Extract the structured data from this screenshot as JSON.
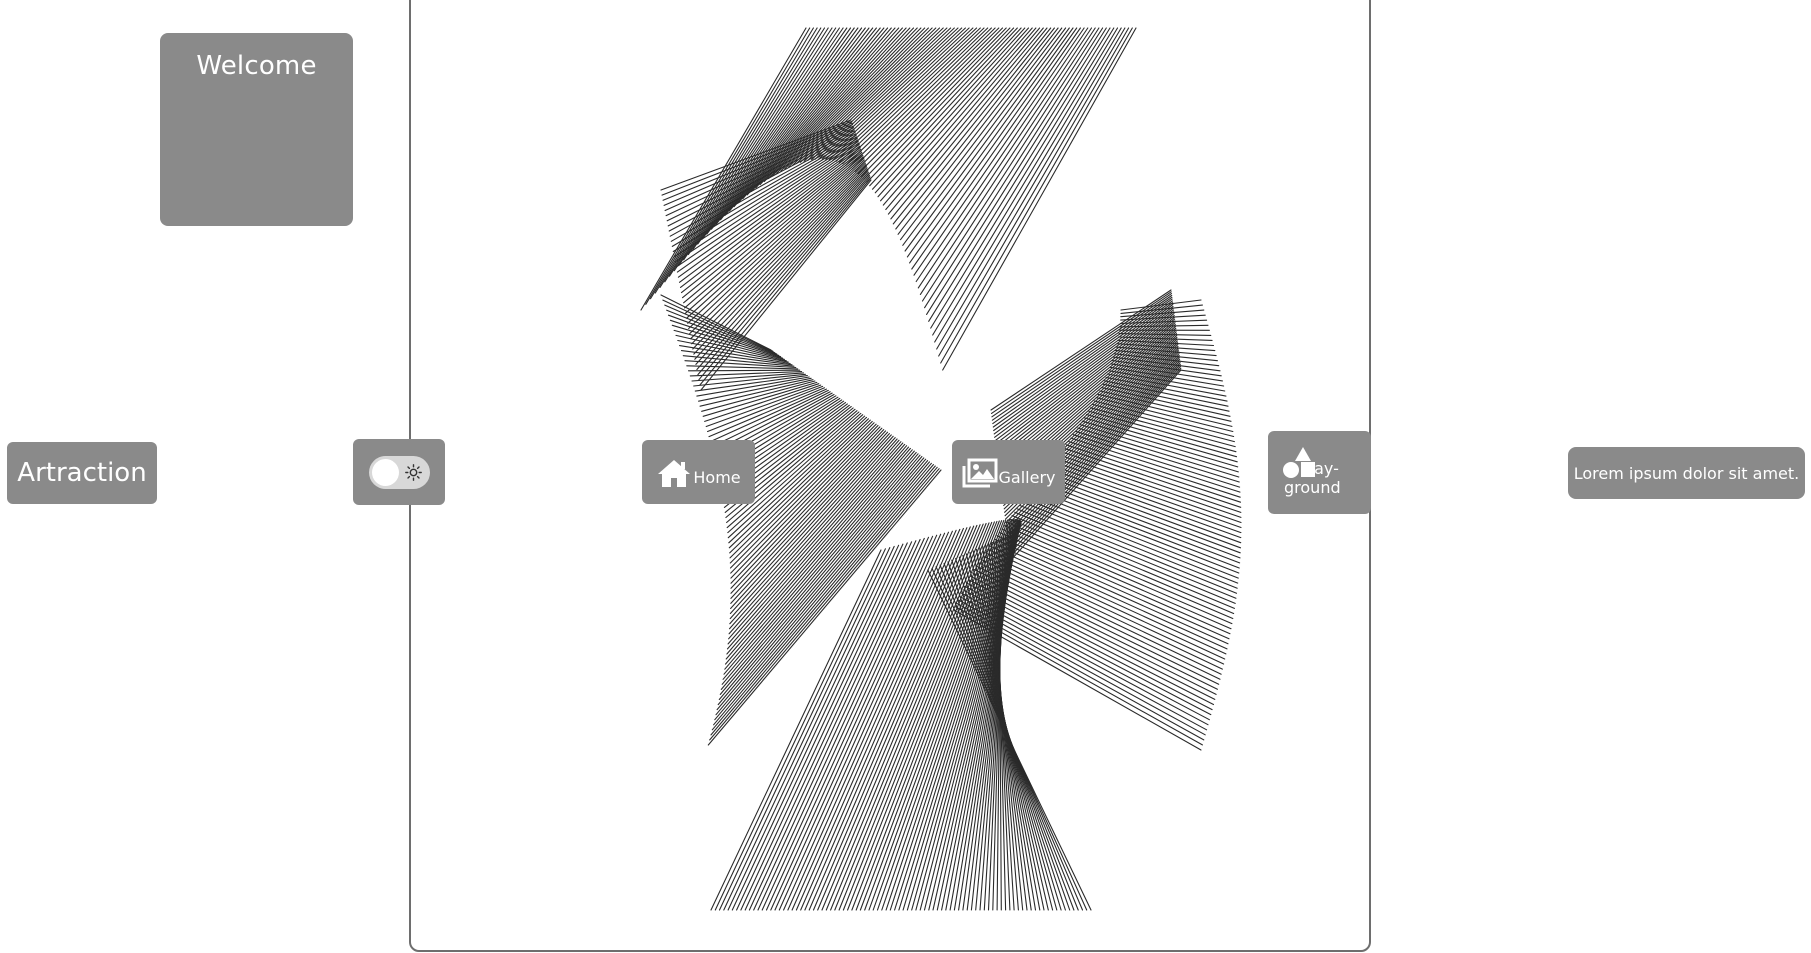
{
  "welcome": {
    "title": "Welcome"
  },
  "brand": {
    "label": "Artraction"
  },
  "theme_toggle": {
    "state": "light",
    "icon": "sun-icon"
  },
  "nav": {
    "home": {
      "label": "Home",
      "icon": "home-icon"
    },
    "gallery": {
      "label": "Gallery",
      "icon": "gallery-icon"
    },
    "playground": {
      "label_line1": "Play-",
      "label_line2": "ground",
      "icon": "shapes-icon"
    }
  },
  "tagline": {
    "text": "Lorem ipsum dolor sit amet."
  },
  "colors": {
    "button_bg": "#8a8a8a",
    "button_text": "#ffffff",
    "frame_border": "#6e6e6e",
    "line_color": "#2a2a2a"
  }
}
